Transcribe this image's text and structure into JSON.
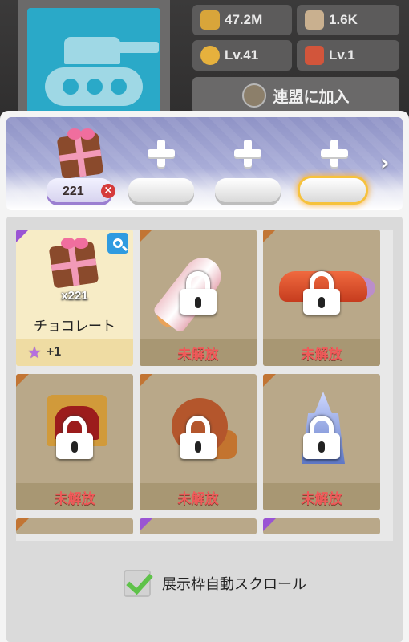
{
  "profile": {
    "stats": [
      {
        "icon": "trophy-icon",
        "value": "47.2M",
        "color": "#d8a53a"
      },
      {
        "icon": "battle-icon",
        "value": "1.6K",
        "color": "#c9b08f"
      },
      {
        "icon": "level-icon",
        "value": "Lv.41",
        "color": "#e6b13d"
      },
      {
        "icon": "gift-icon",
        "value": "Lv.1",
        "color": "#d2553b"
      }
    ],
    "join_label": "連盟に加入"
  },
  "showcase": {
    "slot1_qty": "221",
    "remove_icon": "×",
    "next_icon": "›"
  },
  "items": [
    {
      "name": "チョコレート",
      "qty": "x221",
      "bonus": "+1",
      "status": "owned"
    },
    {
      "status_label": "未解放"
    },
    {
      "status_label": "未解放"
    },
    {
      "status_label": "未解放"
    },
    {
      "status_label": "未解放"
    },
    {
      "status_label": "未解放"
    }
  ],
  "auto_scroll": {
    "label": "展示枠自動スクロール",
    "checked": true
  },
  "colors": {
    "locked_text": "#f05a5a",
    "accent_rarity_orange": "#c27534",
    "accent_rarity_purple": "#9a54d4"
  }
}
